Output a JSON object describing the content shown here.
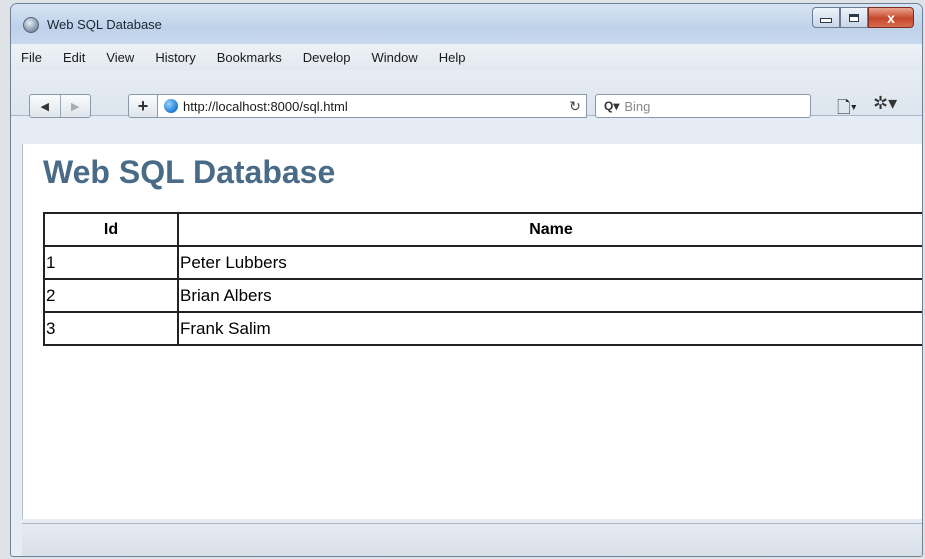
{
  "window": {
    "title": "Web SQL Database",
    "controls": {
      "minimize": "",
      "maximize": "",
      "close": "x"
    }
  },
  "menu": [
    "File",
    "Edit",
    "View",
    "History",
    "Bookmarks",
    "Develop",
    "Window",
    "Help"
  ],
  "nav": {
    "back": "◀",
    "forward": "▶",
    "add": "+",
    "url": "http://localhost:8000/sql.html",
    "reload": "↻",
    "search_placeholder": "Bing",
    "search_glyph": "Q▾",
    "page_menu": "🗋▾",
    "tools_menu": "✲▾"
  },
  "page": {
    "heading": "Web SQL Database",
    "table": {
      "headers": [
        "Id",
        "Name"
      ],
      "rows": [
        [
          "1",
          "Peter Lubbers"
        ],
        [
          "2",
          "Brian Albers"
        ],
        [
          "3",
          "Frank Salim"
        ]
      ]
    }
  },
  "colors": {
    "heading": "#4a6b88",
    "close_button": "#c6472b"
  }
}
